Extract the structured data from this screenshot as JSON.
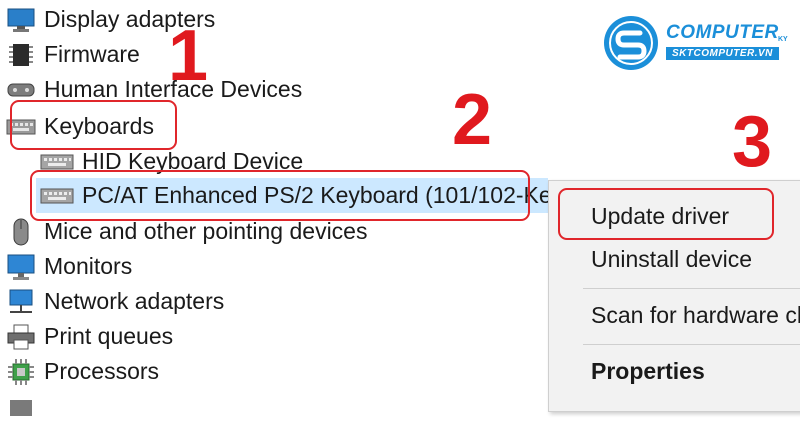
{
  "tree": {
    "items": [
      {
        "label": "Display adapters",
        "icon": "display-adapter-icon"
      },
      {
        "label": "Firmware",
        "icon": "firmware-chip-icon"
      },
      {
        "label": "Human Interface Devices",
        "icon": "hid-icon"
      },
      {
        "label": "Keyboards",
        "icon": "keyboard-icon"
      },
      {
        "label": "HID Keyboard Device",
        "icon": "keyboard-icon"
      },
      {
        "label": "PC/AT Enhanced PS/2 Keyboard (101/102-Key",
        "icon": "keyboard-icon"
      },
      {
        "label": "Mice and other pointing devices",
        "icon": "mouse-icon"
      },
      {
        "label": "Monitors",
        "icon": "monitor-icon"
      },
      {
        "label": "Network adapters",
        "icon": "network-adapter-icon"
      },
      {
        "label": "Print queues",
        "icon": "printer-icon"
      },
      {
        "label": "Processors",
        "icon": "processor-icon"
      }
    ]
  },
  "context_menu": {
    "update_driver": "Update driver",
    "uninstall_device": "Uninstall device",
    "scan_hardware": "Scan for hardware ch",
    "properties": "Properties"
  },
  "step_numbers": {
    "one": "1",
    "two": "2",
    "three": "3"
  },
  "logo": {
    "brand": "COMPUTER",
    "suffix": "KY",
    "site": "SKTCOMPUTER.VN"
  },
  "colors": {
    "highlight": "#e0262b",
    "step_number": "#e0191e",
    "selection": "#cce8ff",
    "brand": "#1b8fd9"
  }
}
